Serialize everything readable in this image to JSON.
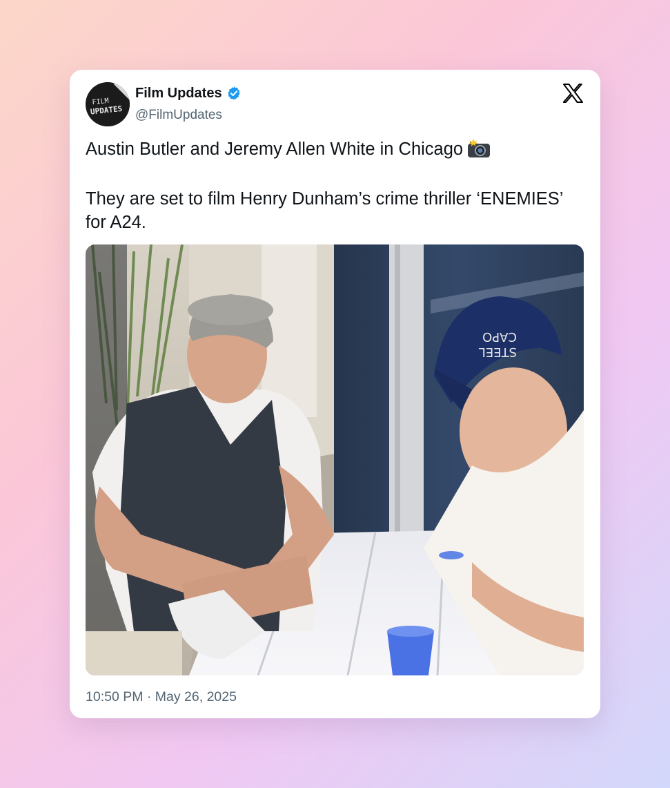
{
  "tweet": {
    "author": {
      "display_name": "Film Updates",
      "handle": "@FilmUpdates",
      "verified": true,
      "avatar_text_line1": "FILM",
      "avatar_text_line2": "UPDATES"
    },
    "text_line1": "Austin Butler and Jeremy Allen White in Chicago",
    "emoji": "camera-with-flash-icon",
    "text_line2": "They are set to film Henry Dunham’s crime thriller ‘ENEMIES’ for A24.",
    "media": {
      "description_icon": "photo",
      "hat_text_line1": "CAPO",
      "hat_text_line2": "STEEL"
    },
    "timestamp": "10:50 PM · May 26, 2025"
  },
  "platform": {
    "logo": "x-logo-icon"
  },
  "colors": {
    "text_primary": "#0f1419",
    "text_secondary": "#536471",
    "verified_blue": "#1d9bf0",
    "card_background": "#ffffff"
  }
}
